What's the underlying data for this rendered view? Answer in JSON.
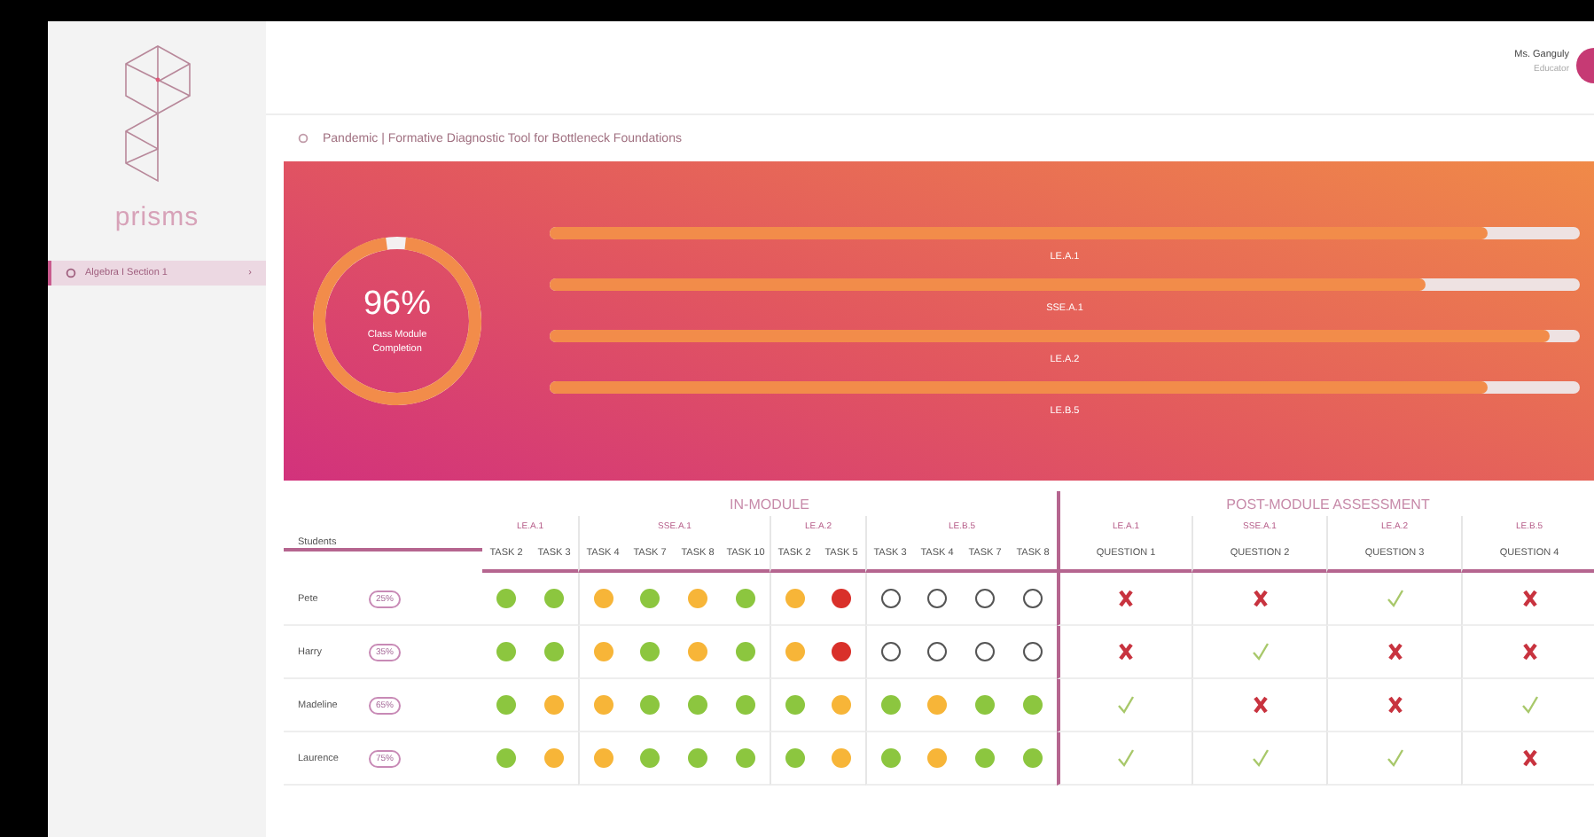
{
  "sidebar": {
    "logo": "prisms",
    "items": [
      {
        "label": "Algebra I Section 1",
        "selected": true,
        "chevron": "›"
      }
    ]
  },
  "header": {
    "user_name": "Ms. Ganguly",
    "user_role": "Educator"
  },
  "breadcrumb": "Pandemic | Formative Diagnostic Tool for Bottleneck Foundations",
  "summary": {
    "completion": {
      "value": "96%",
      "label": "Class Module Completion",
      "level": 0.96
    },
    "standards": [
      {
        "label": "LE.A.1",
        "level": 0.91
      },
      {
        "label": "SSE.A.1",
        "level": 0.85
      },
      {
        "label": "LE.A.2",
        "level": 0.97
      },
      {
        "label": "LE.B.5",
        "level": 0.91
      }
    ]
  },
  "table": {
    "students_heading": "Students",
    "in_module": {
      "title": "IN-MODULE",
      "groups": [
        {
          "label": "LE.A.1",
          "tasks": [
            "TASK 2",
            "TASK 3"
          ]
        },
        {
          "label": "SSE.A.1",
          "tasks": [
            "TASK 4",
            "TASK 7",
            "TASK 8",
            "TASK 10"
          ]
        },
        {
          "label": "LE.A.2",
          "tasks": [
            "TASK 2",
            "TASK 5"
          ]
        },
        {
          "label": "LE.B.5",
          "tasks": [
            "TASK 3",
            "TASK 4",
            "TASK 7",
            "TASK 8"
          ]
        }
      ]
    },
    "post_module": {
      "title": "POST-MODULE ASSESSMENT",
      "questions": [
        {
          "standard": "LE.A.1",
          "label": "QUESTION 1"
        },
        {
          "standard": "SSE.A.1",
          "label": "QUESTION 2"
        },
        {
          "standard": "LE.A.2",
          "label": "QUESTION 3"
        },
        {
          "standard": "LE.B.5",
          "label": "QUESTION 4"
        }
      ]
    },
    "rows": [
      {
        "name": "Pete",
        "score": "25%",
        "tasks": [
          {
            "kind": "dot",
            "color": "#8cc63f"
          },
          {
            "kind": "dot",
            "color": "#8cc63f"
          },
          {
            "kind": "dot",
            "color": "#f7b538"
          },
          {
            "kind": "dot",
            "color": "#8cc63f"
          },
          {
            "kind": "dot",
            "color": "#f7b538"
          },
          {
            "kind": "dot",
            "color": "#8cc63f"
          },
          {
            "kind": "dot",
            "color": "#f7b538"
          },
          {
            "kind": "dot",
            "color": "#d9302a"
          },
          {
            "kind": "empty"
          },
          {
            "kind": "empty"
          },
          {
            "kind": "empty"
          },
          {
            "kind": "empty"
          }
        ],
        "answers": [
          {
            "correct": false
          },
          {
            "correct": false
          },
          {
            "correct": true
          },
          {
            "correct": false
          }
        ]
      },
      {
        "name": "Harry",
        "score": "35%",
        "tasks": [
          {
            "kind": "dot",
            "color": "#8cc63f"
          },
          {
            "kind": "dot",
            "color": "#8cc63f"
          },
          {
            "kind": "dot",
            "color": "#f7b538"
          },
          {
            "kind": "dot",
            "color": "#8cc63f"
          },
          {
            "kind": "dot",
            "color": "#f7b538"
          },
          {
            "kind": "dot",
            "color": "#8cc63f"
          },
          {
            "kind": "dot",
            "color": "#f7b538"
          },
          {
            "kind": "dot",
            "color": "#d9302a"
          },
          {
            "kind": "empty"
          },
          {
            "kind": "empty"
          },
          {
            "kind": "empty"
          },
          {
            "kind": "empty"
          }
        ],
        "answers": [
          {
            "correct": false
          },
          {
            "correct": true
          },
          {
            "correct": false
          },
          {
            "correct": false
          }
        ]
      },
      {
        "name": "Madeline",
        "score": "65%",
        "tasks": [
          {
            "kind": "dot",
            "color": "#8cc63f"
          },
          {
            "kind": "dot",
            "color": "#f7b538"
          },
          {
            "kind": "dot",
            "color": "#f7b538"
          },
          {
            "kind": "dot",
            "color": "#8cc63f"
          },
          {
            "kind": "dot",
            "color": "#8cc63f"
          },
          {
            "kind": "dot",
            "color": "#8cc63f"
          },
          {
            "kind": "dot",
            "color": "#8cc63f"
          },
          {
            "kind": "dot",
            "color": "#f7b538"
          },
          {
            "kind": "dot",
            "color": "#8cc63f"
          },
          {
            "kind": "dot",
            "color": "#f7b538"
          },
          {
            "kind": "dot",
            "color": "#8cc63f"
          },
          {
            "kind": "dot",
            "color": "#8cc63f"
          }
        ],
        "answers": [
          {
            "correct": true
          },
          {
            "correct": false
          },
          {
            "correct": false
          },
          {
            "correct": true
          }
        ]
      },
      {
        "name": "Laurence",
        "score": "75%",
        "tasks": [
          {
            "kind": "dot",
            "color": "#8cc63f"
          },
          {
            "kind": "dot",
            "color": "#f7b538"
          },
          {
            "kind": "dot",
            "color": "#f7b538"
          },
          {
            "kind": "dot",
            "color": "#8cc63f"
          },
          {
            "kind": "dot",
            "color": "#8cc63f"
          },
          {
            "kind": "dot",
            "color": "#8cc63f"
          },
          {
            "kind": "dot",
            "color": "#8cc63f"
          },
          {
            "kind": "dot",
            "color": "#f7b538"
          },
          {
            "kind": "dot",
            "color": "#8cc63f"
          },
          {
            "kind": "dot",
            "color": "#f7b538"
          },
          {
            "kind": "dot",
            "color": "#8cc63f"
          },
          {
            "kind": "dot",
            "color": "#8cc63f"
          }
        ],
        "answers": [
          {
            "correct": true
          },
          {
            "correct": true
          },
          {
            "correct": true
          },
          {
            "correct": false
          }
        ]
      }
    ]
  }
}
